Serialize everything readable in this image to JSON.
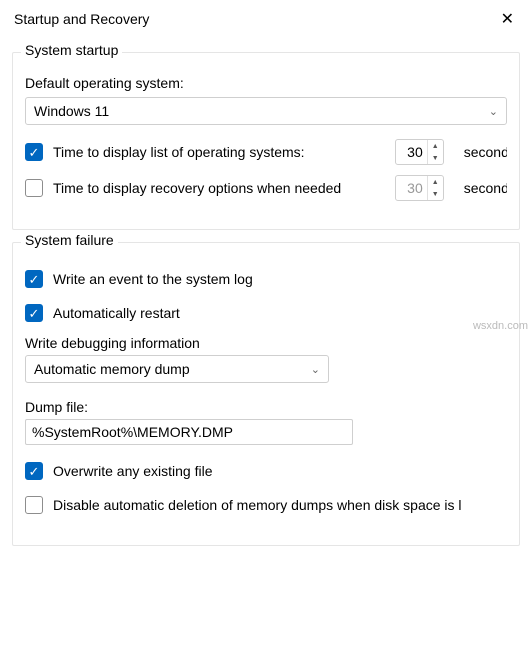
{
  "window": {
    "title": "Startup and Recovery"
  },
  "startup": {
    "legend": "System startup",
    "default_os_label": "Default operating system:",
    "default_os_value": "Windows 11",
    "time_list_label": "Time to display list of operating systems:",
    "time_list_value": "30",
    "time_list_unit": "seconds",
    "time_recovery_label": "Time to display recovery options when needed",
    "time_recovery_value": "30",
    "time_recovery_unit": "seconds"
  },
  "failure": {
    "legend": "System failure",
    "write_event_label": "Write an event to the system log",
    "auto_restart_label": "Automatically restart",
    "debug_info_label": "Write debugging information",
    "debug_info_value": "Automatic memory dump",
    "dump_file_label": "Dump file:",
    "dump_file_value": "%SystemRoot%\\MEMORY.DMP",
    "overwrite_label": "Overwrite any existing file",
    "disable_deletion_label": "Disable automatic deletion of memory dumps when disk space is l"
  },
  "watermark": "wsxdn.com"
}
